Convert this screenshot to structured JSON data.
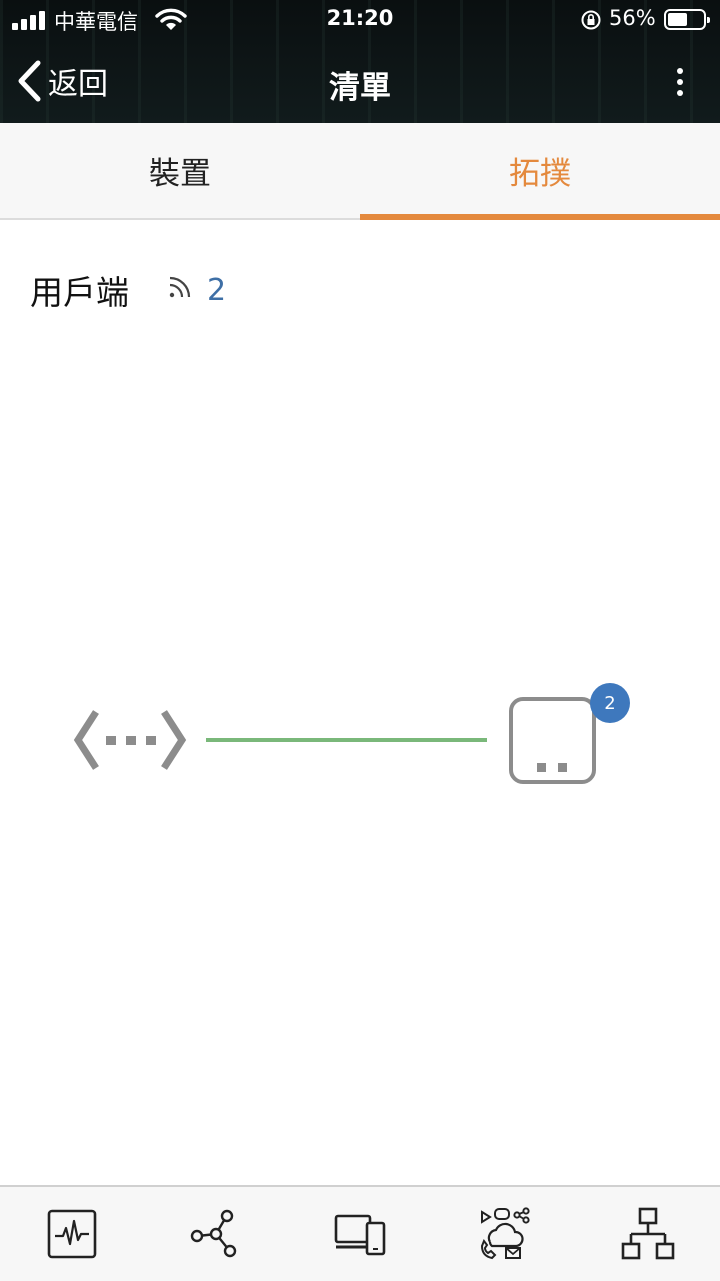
{
  "status_bar": {
    "carrier": "中華電信",
    "time": "21:20",
    "battery_percent": "56%",
    "battery_level": 0.56
  },
  "nav": {
    "back_label": "返回",
    "title": "清單"
  },
  "tabs": [
    {
      "label": "裝置",
      "active": false
    },
    {
      "label": "拓撲",
      "active": true
    }
  ],
  "clients": {
    "label": "用戶端",
    "count": "2"
  },
  "topology": {
    "client_badge": "2",
    "link_color": "#7ab87a"
  },
  "bottom_nav": [
    {
      "icon": "activity-monitor-icon"
    },
    {
      "icon": "network-graph-icon"
    },
    {
      "icon": "devices-icon"
    },
    {
      "icon": "applications-icon"
    },
    {
      "icon": "topology-tree-icon"
    }
  ],
  "colors": {
    "accent": "#e4893d",
    "count_blue": "#3e6fa6",
    "badge_blue": "#3e78bd"
  }
}
